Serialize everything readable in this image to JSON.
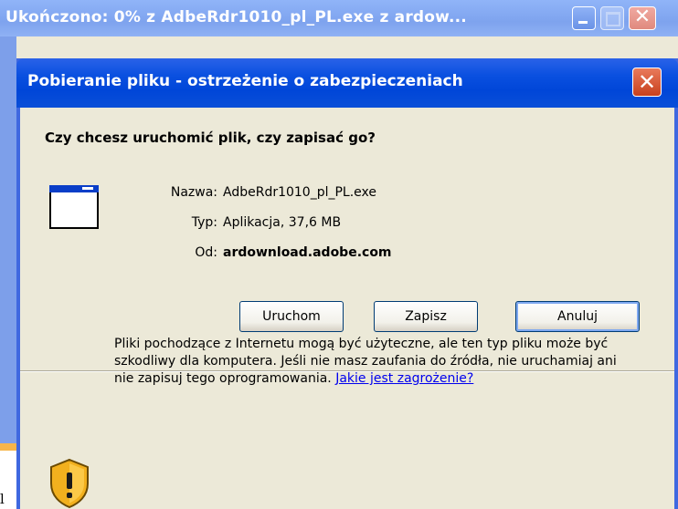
{
  "background_window": {
    "title": "Ukończono: 0% z AdbeRdr1010_pl_PL.exe z ardow...",
    "close_glyph": "✕"
  },
  "dialog": {
    "title": "Pobieranie pliku - ostrzeżenie o zabezpieczeniach",
    "close_glyph": "✕",
    "question": "Czy chcesz uruchomić plik, czy zapisać go?",
    "fields": {
      "name_label": "Nazwa:",
      "name_value": "AdbeRdr1010_pl_PL.exe",
      "type_label": "Typ:",
      "type_value": "Aplikacja, 37,6 MB",
      "from_label": "Od:",
      "from_value": "ardownload.adobe.com"
    },
    "buttons": {
      "run": "Uruchom",
      "save": "Zapisz",
      "cancel": "Anuluj"
    },
    "warning_text": "Pliki pochodzące z Internetu mogą być użyteczne, ale ten typ pliku może być szkodliwy dla komputera. Jeśli nie masz zaufania do źródła, nie uruchamiaj ani nie zapisuj tego oprogramowania.",
    "warning_link": "Jakie jest zagrożenie?",
    "icons": [
      "file-icon",
      "security-shield-icon"
    ]
  },
  "stray_text": "l",
  "colors": {
    "dialog_title": "#0046d8",
    "dialog_body": "#ece9d8",
    "link": "#0000ee",
    "shield": "#f2b01e"
  }
}
